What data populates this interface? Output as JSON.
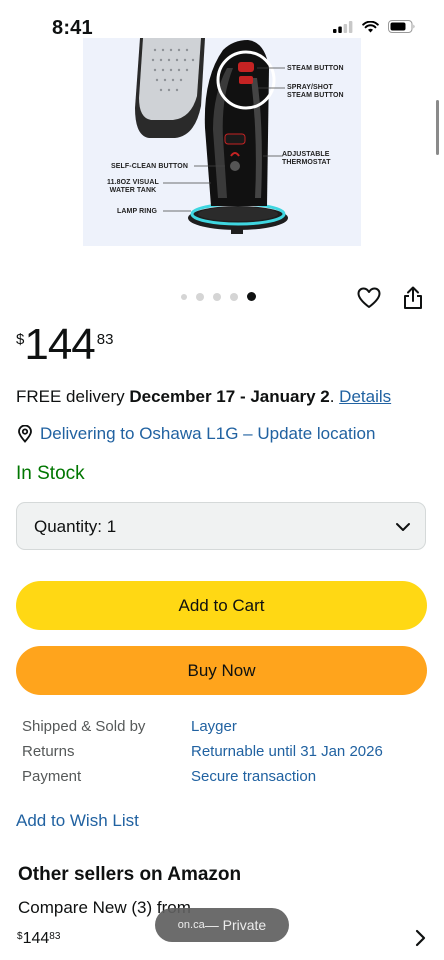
{
  "status_bar": {
    "time": "8:41",
    "icons": [
      "cellular-signal-icon",
      "wifi-icon",
      "battery-icon"
    ]
  },
  "product_image": {
    "callouts": {
      "steam_button": "STEAM BUTTON",
      "spray_shot": "SPRAY/SHOT\nSTEAM BUTTON",
      "thermostat": "ADJUSTABLE\nTHERMOSTAT",
      "self_clean": "SELF-CLEAN BUTTON",
      "water_tank": "11.8OZ VISUAL\nWATER TANK",
      "lamp_ring": "LAMP RING"
    }
  },
  "carousel": {
    "total": 5,
    "active_index": 4
  },
  "actions": {
    "icons": [
      "heart-icon",
      "share-icon"
    ]
  },
  "price": {
    "symbol": "$",
    "whole": "144",
    "fraction": "83"
  },
  "delivery": {
    "prefix": "FREE delivery ",
    "dates": "December 17 - January 2",
    "separator": ". ",
    "details_link": "Details"
  },
  "location": {
    "text": "Delivering to Oshawa L1G – Update location"
  },
  "stock": "In Stock",
  "quantity": {
    "label": "Quantity: 1"
  },
  "buttons": {
    "add_to_cart": "Add to Cart",
    "buy_now": "Buy Now"
  },
  "seller_info": [
    {
      "label": "Shipped & Sold by",
      "value": "Layger"
    },
    {
      "label": "Returns",
      "value": "Returnable until 31 Jan 2026"
    },
    {
      "label": "Payment",
      "value": "Secure transaction"
    }
  ],
  "wishlist": "Add to Wish List",
  "other_sellers": {
    "title": "Other sellers on Amazon",
    "compare": "Compare New (3) from",
    "price": {
      "symbol": "$",
      "whole": "144",
      "fraction": "83"
    }
  },
  "safari_pill": {
    "domain": "on.ca",
    "text": " — Private"
  },
  "colors": {
    "link": "#2162a1",
    "in_stock": "#007600",
    "add_to_cart": "#ffd814",
    "buy_now": "#ffa41c"
  }
}
